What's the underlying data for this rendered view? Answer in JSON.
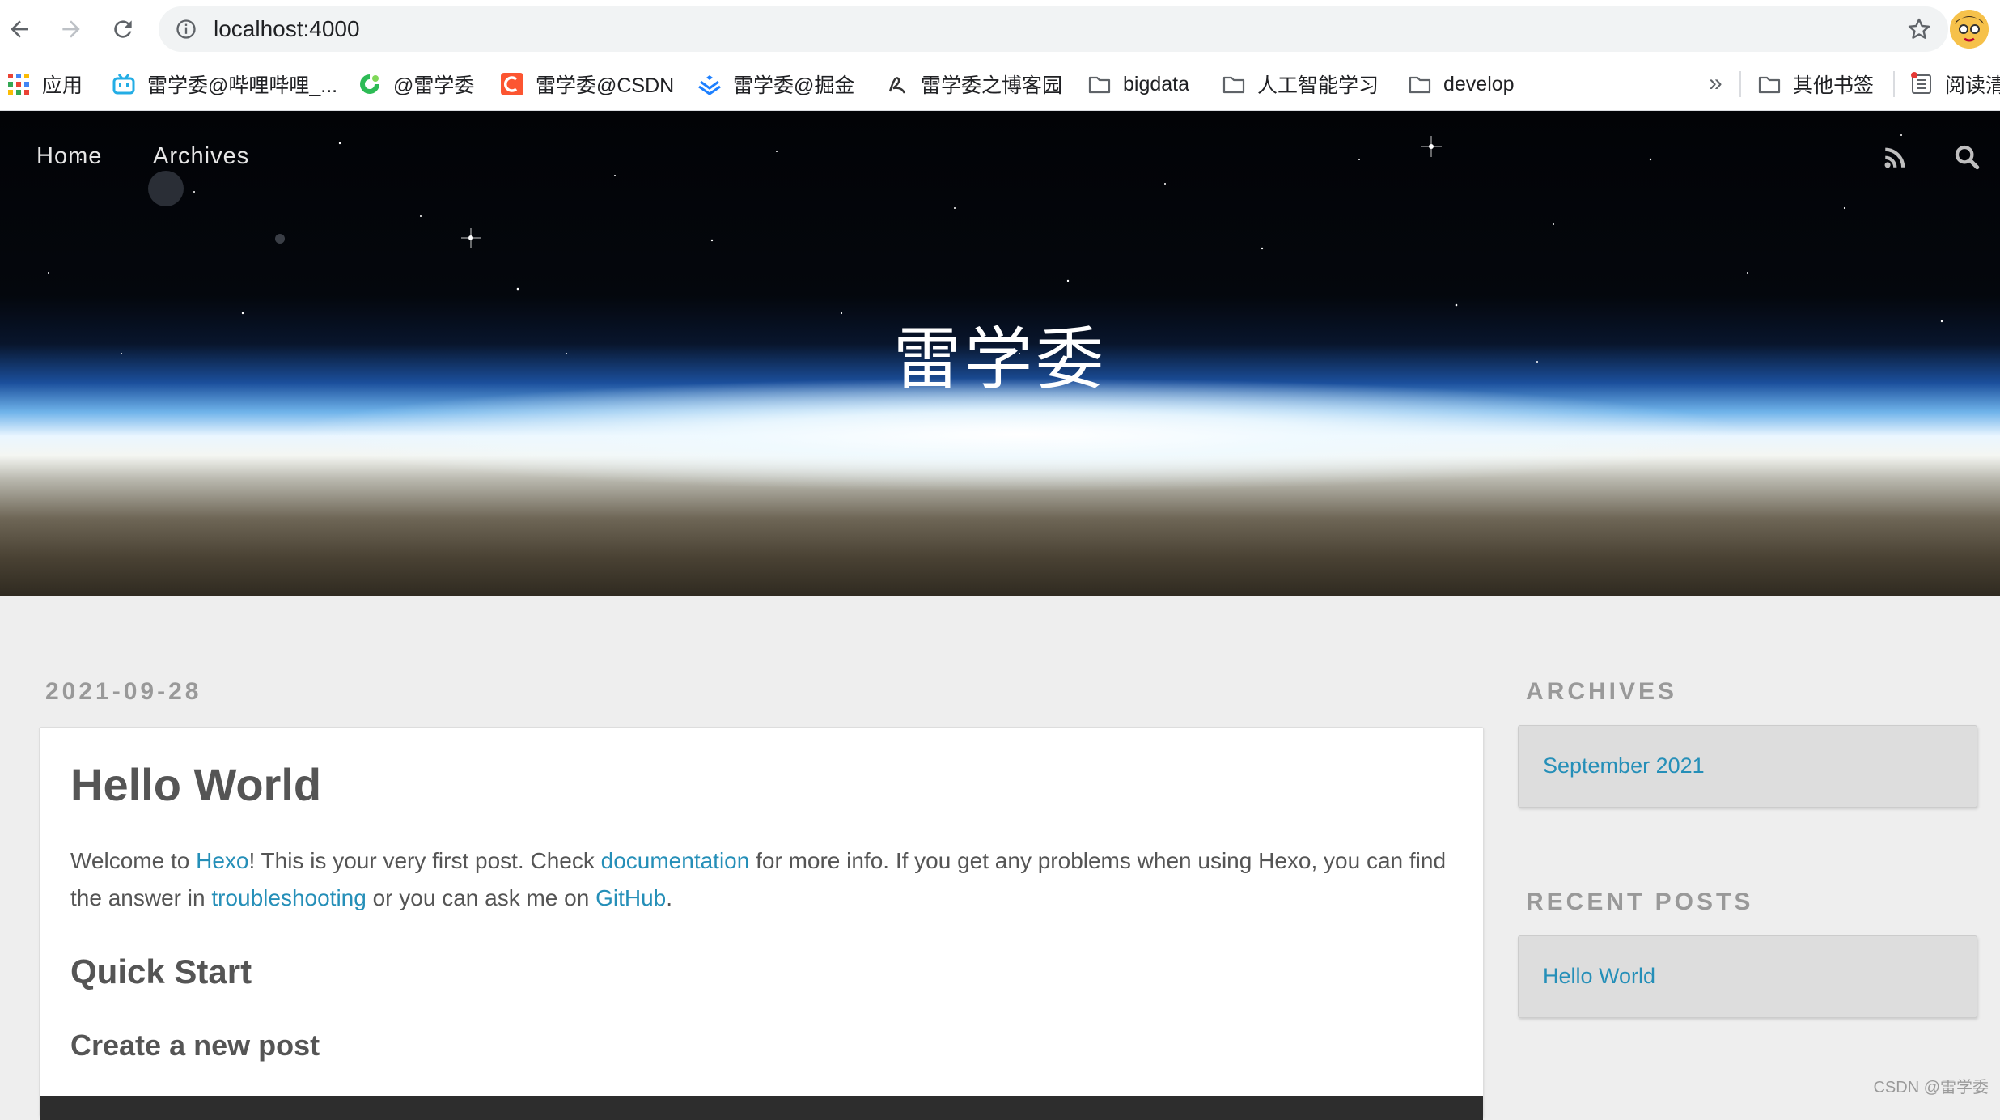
{
  "browser": {
    "url": "localhost:4000",
    "icons": [
      "back-icon",
      "forward-icon",
      "reload-icon",
      "info-icon",
      "star-icon"
    ]
  },
  "bookmarks": {
    "items": [
      {
        "label": "应用",
        "icon": "apps-grid-icon"
      },
      {
        "label": "雷学委@哔哩哔哩_...",
        "icon": "bilibili-icon"
      },
      {
        "label": "@雷学委",
        "icon": "green-logo-icon"
      },
      {
        "label": "雷学委@CSDN",
        "icon": "csdn-icon"
      },
      {
        "label": "雷学委@掘金",
        "icon": "juejin-icon"
      },
      {
        "label": "雷学委之博客园",
        "icon": "cnblogs-icon"
      },
      {
        "label": "bigdata",
        "icon": "folder-icon"
      },
      {
        "label": "人工智能学习",
        "icon": "folder-icon"
      },
      {
        "label": "develop",
        "icon": "folder-icon"
      }
    ],
    "overflow": "»",
    "other": {
      "label": "其他书签",
      "icon": "folder-icon"
    },
    "reading": {
      "label": "阅读清",
      "icon": "reading-list-icon"
    }
  },
  "site": {
    "title": "雷学委",
    "nav": [
      {
        "label": "Home"
      },
      {
        "label": "Archives"
      }
    ],
    "icons": [
      "rss-icon",
      "search-icon"
    ]
  },
  "post": {
    "date": "2021-09-28",
    "title": "Hello World",
    "p1_a": "Welcome to ",
    "link_hexo": "Hexo",
    "p1_b": "! This is your very first post. Check ",
    "link_docs": "documentation",
    "p1_c": " for more info. If you get any problems when using Hexo, you can find the answer in ",
    "link_trouble": "troubleshooting",
    "p1_d": " or you can ask me on ",
    "link_github": "GitHub",
    "p1_e": ".",
    "h2": "Quick Start",
    "h3": "Create a new post"
  },
  "sidebar": {
    "archives_title": "ARCHIVES",
    "archives_item": "September 2021",
    "recent_title": "RECENT POSTS",
    "recent_item": "Hello World"
  },
  "watermark": "CSDN @雷学委",
  "colors": {
    "link": "#258fb8",
    "text": "#555555",
    "muted": "#999999"
  }
}
